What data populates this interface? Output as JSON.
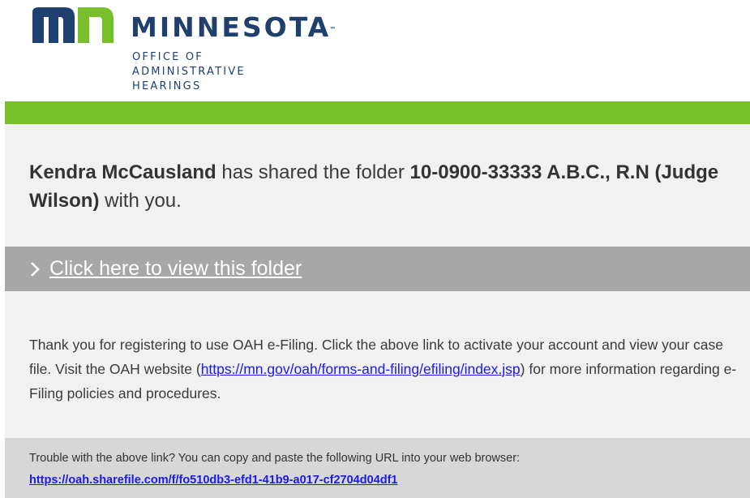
{
  "header": {
    "org_name": "MINNESOTA",
    "trademark": "™",
    "office_lines": [
      "OFFICE OF",
      "ADMINISTRATIVE",
      "HEARINGS"
    ],
    "brand_color": "#1f3f6e",
    "accent_color": "#77bf2b",
    "logo_icon": "mn-logo-icon"
  },
  "share": {
    "sharer_name": "Kendra McCausland",
    "text_1": " has shared the folder ",
    "folder_name": "10-0900-33333 A.B.C., R.N (Judge Wilson)",
    "text_2": " with you."
  },
  "link_bar": {
    "chevron_icon": "chevron-right-icon",
    "link_text": "Click here to view this folder"
  },
  "body": {
    "text_1": "Thank you for registering to use OAH e-Filing. Click the above link to activate your account and view your case file. Visit the OAH website (",
    "website_link": "https://mn.gov/oah/forms-and-filing/efiling/index.jsp",
    "text_2": ") for more information regarding e-Filing policies and procedures."
  },
  "trouble": {
    "text": "Trouble with the above link? You can copy and paste the following URL into your web browser:",
    "url": "https://oah.sharefile.com/f/fo510db3-efd1-41b9-a017-cf2704d04df1"
  }
}
